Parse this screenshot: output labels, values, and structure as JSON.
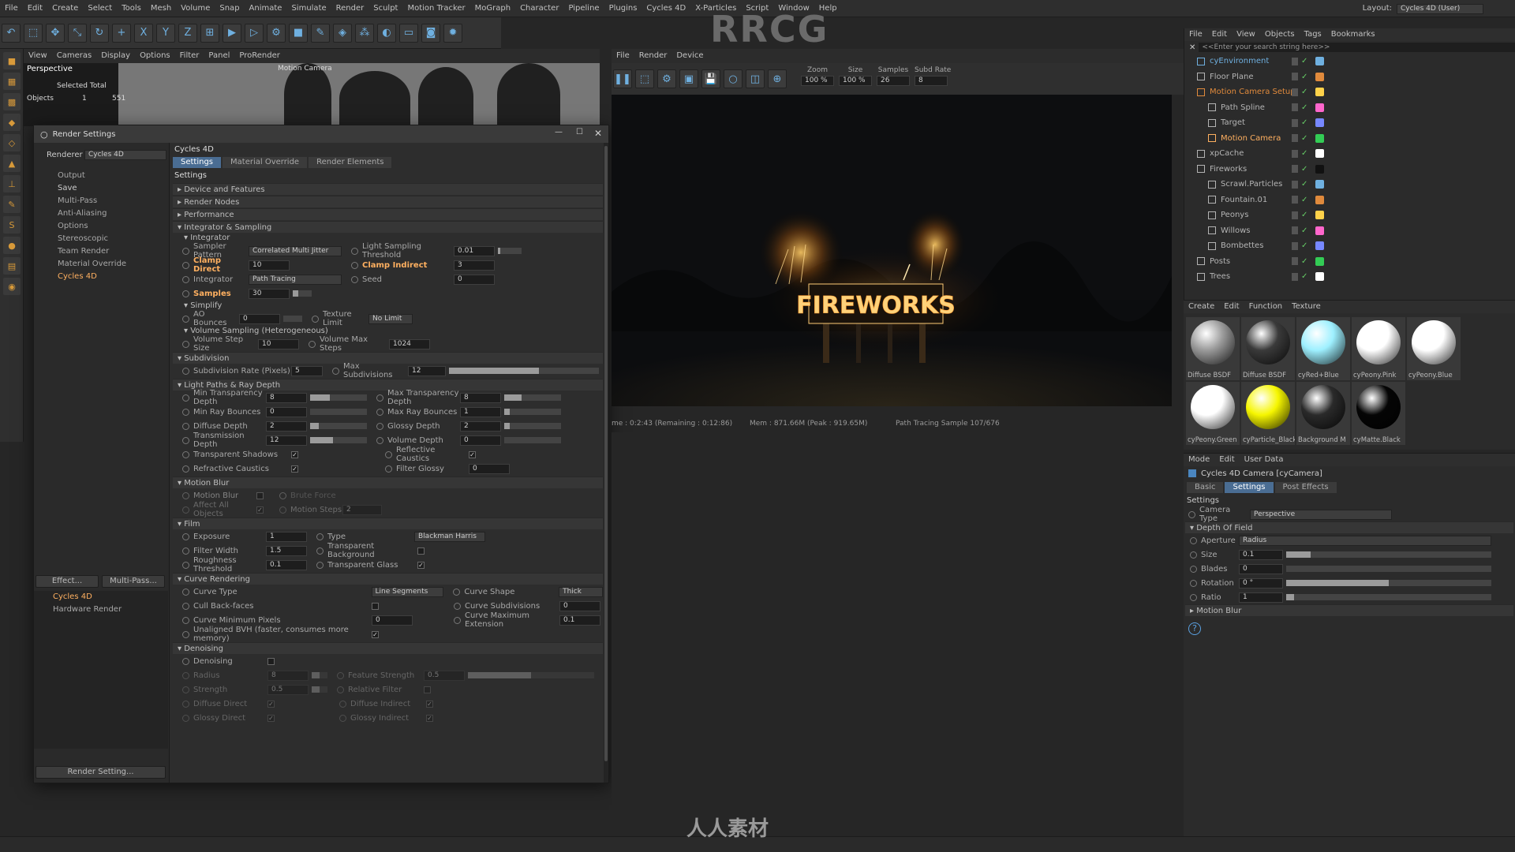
{
  "menubar": {
    "items": [
      "File",
      "Edit",
      "Create",
      "Select",
      "Tools",
      "Mesh",
      "Volume",
      "Snap",
      "Animate",
      "Simulate",
      "Render",
      "Sculpt",
      "Motion Tracker",
      "MoGraph",
      "Character",
      "Pipeline",
      "Plugins",
      "Cycles 4D",
      "X-Particles",
      "Script",
      "Window",
      "Help"
    ],
    "layout_label": "Layout:",
    "layout_value": "Cycles 4D (User)"
  },
  "watermark": {
    "top": "RRCG",
    "footer": "人人素材"
  },
  "toolbar": {
    "icons": [
      "undo-icon",
      "select-icon",
      "move-icon",
      "scale-icon",
      "rotate-icon",
      "add-icon",
      "x-axis-icon",
      "y-axis-icon",
      "z-axis-icon",
      "coord-icon",
      "render-view-icon",
      "render-pv-icon",
      "render-settings-icon",
      "cube-icon",
      "pen-icon",
      "subdiv-icon",
      "array-icon",
      "deformer-icon",
      "floor-icon",
      "camera-icon",
      "light-icon"
    ]
  },
  "viewport": {
    "menu": [
      "View",
      "Cameras",
      "Display",
      "Options",
      "Filter",
      "Panel",
      "ProRender"
    ],
    "name": "Perspective",
    "camera": "Motion Camera ",
    "selected_total": "Selected Total",
    "objects_label": "Objects",
    "objects_value": "1",
    "objects_count": "551"
  },
  "dialog": {
    "title": "Render Settings",
    "renderer_label": "Renderer",
    "renderer_value": "Cycles 4D",
    "left_items": [
      "Output",
      "Save",
      "Multi-Pass",
      "Anti-Aliasing",
      "Options",
      "Stereoscopic",
      "Team Render",
      "Material Override",
      "Cycles 4D"
    ],
    "effect_button": "Effect...",
    "multipass_button": "Multi-Pass...",
    "render_list": [
      "Cycles 4D",
      "Hardware Render"
    ],
    "render_setting_button": "Render Setting...",
    "panel_title": "Cycles 4D",
    "tabs": [
      "Settings",
      "Material Override",
      "Render Elements"
    ],
    "settings_label": "Settings",
    "sections": {
      "device": "Device and Features",
      "nodes": "Render Nodes",
      "performance": "Performance",
      "integrator_sampling": "Integrator & Sampling",
      "integrator": "Integrator",
      "simplify": "Simplify",
      "volume": "Volume Sampling (Heterogeneous)",
      "subdivision": "Subdivision",
      "lightpaths": "Light Paths & Ray Depth",
      "motionblur": "Motion Blur",
      "film": "Film",
      "curve": "Curve Rendering",
      "denoising": "Denoising"
    },
    "integrator": {
      "sampler_pattern_label": "Sampler Pattern",
      "sampler_pattern_value": "Correlated Multi Jitter",
      "light_threshold_label": "Light Sampling Threshold",
      "light_threshold_value": "0.01",
      "clamp_direct_label": "Clamp Direct",
      "clamp_direct_value": "10",
      "clamp_indirect_label": "Clamp Indirect",
      "clamp_indirect_value": "3",
      "integrator_label": "Integrator",
      "integrator_value": "Path Tracing",
      "seed_label": "Seed",
      "seed_value": "0",
      "samples_label": "Samples",
      "samples_value": "30"
    },
    "simplify": {
      "ao_label": "AO Bounces",
      "ao_value": "0",
      "texlimit_label": "Texture Limit",
      "texlimit_value": "No Limit"
    },
    "volume": {
      "step_label": "Volume Step Size",
      "step_value": "10",
      "maxsteps_label": "Volume Max Steps",
      "maxsteps_value": "1024"
    },
    "subdivision": {
      "rate_label": "Subdivision Rate (Pixels)",
      "rate_value": "5",
      "max_label": "Max Subdivisions",
      "max_value": "12"
    },
    "lightpaths": {
      "min_trans_label": "Min Transparency Depth",
      "min_trans_value": "8",
      "max_trans_label": "Max Transparency Depth",
      "max_trans_value": "8",
      "min_ray_label": "Min Ray Bounces",
      "min_ray_value": "0",
      "max_ray_label": "Max Ray Bounces",
      "max_ray_value": "1",
      "diffuse_label": "Diffuse Depth",
      "diffuse_value": "2",
      "glossy_label": "Glossy Depth",
      "glossy_value": "2",
      "transmission_label": "Transmission Depth",
      "transmission_value": "12",
      "volume_label": "Volume Depth",
      "volume_value": "0",
      "trans_shadows_label": "Transparent Shadows",
      "refl_caustics_label": "Reflective Caustics",
      "refr_caustics_label": "Refractive Caustics",
      "filter_glossy_label": "Filter Glossy",
      "filter_glossy_value": "0"
    },
    "motionblur": {
      "mb_label": "Motion Blur",
      "brute_label": "Brute Force",
      "affect_label": "Affect All Objects",
      "mb_steps_label": "Motion Steps",
      "mb_steps_value": "2"
    },
    "film": {
      "exposure_label": "Exposure",
      "exposure_value": "1",
      "type_label": "Type",
      "type_value": "Blackman Harris",
      "filter_width_label": "Filter Width",
      "filter_width_value": "1.5",
      "trans_bg_label": "Transparent Background",
      "roughness_label": "Roughness Threshold",
      "roughness_value": "0.1",
      "trans_glass_label": "Transparent Glass"
    },
    "curve": {
      "type_label": "Curve Type",
      "type_value": "Line Segments",
      "shape_label": "Curve Shape",
      "shape_value": "Thick",
      "cull_label": "Cull Back-faces",
      "subdiv_label": "Curve Subdivisions",
      "subdiv_value": "0",
      "minpix_label": "Curve Minimum Pixels",
      "minpix_value": "0",
      "maxext_label": "Curve Maximum Extension",
      "maxext_value": "0.1",
      "bvh_label": "Unaligned BVH (faster, consumes more memory)"
    },
    "denoising": {
      "denoise_label": "Denoising",
      "radius_label": "Radius",
      "radius_value": "8",
      "feature_label": "Feature Strength",
      "feature_value": "0.5",
      "strength_label": "Strength",
      "strength_value": "0.5",
      "relative_label": "Relative Filter",
      "diffuse_direct_label": "Diffuse Direct",
      "diffuse_indirect_label": "Diffuse Indirect",
      "glossy_direct_label": "Glossy Direct",
      "glossy_indirect_label": "Glossy Indirect"
    }
  },
  "renderview": {
    "menu": [
      "File",
      "Render",
      "Device"
    ],
    "zoom_label": "Zoom",
    "zoom_value": "100 %",
    "size_label": "Size",
    "size_value": "100 %",
    "samples_label": "Samples",
    "samples_value": "26",
    "subd_label": "Subd Rate",
    "subd_value": "8",
    "sign_text": "FIREWORKS",
    "status_time": "me : 0:2:43 (Remaining : 0:12:86)",
    "status_mem": "Mem : 871.66M (Peak : 919.65M)",
    "status_sample": "Path Tracing Sample 107/676"
  },
  "objects": {
    "menu": [
      "File",
      "Edit",
      "View",
      "Objects",
      "Tags",
      "Bookmarks"
    ],
    "search_placeholder": "<<Enter your search string here>>",
    "rows": [
      {
        "name": "cyEnvironment",
        "indent": 0,
        "color": "#6fb0e0"
      },
      {
        "name": "Floor Plane",
        "indent": 0,
        "color": "#b4b4b4"
      },
      {
        "name": "Motion Camera Setup",
        "indent": 0,
        "color": "#e08a3c"
      },
      {
        "name": "Path Spline",
        "indent": 1,
        "color": "#b4b4b4"
      },
      {
        "name": "Target",
        "indent": 1,
        "color": "#b4b4b4"
      },
      {
        "name": "Motion Camera",
        "indent": 1,
        "color": "#ffb060"
      },
      {
        "name": "xpCache",
        "indent": 0,
        "color": "#b4b4b4"
      },
      {
        "name": "Fireworks",
        "indent": 0,
        "color": "#b4b4b4"
      },
      {
        "name": "Scrawl.Particles",
        "indent": 1,
        "color": "#b4b4b4"
      },
      {
        "name": "Fountain.01",
        "indent": 1,
        "color": "#b4b4b4"
      },
      {
        "name": "Peonys",
        "indent": 1,
        "color": "#b4b4b4"
      },
      {
        "name": "Willows",
        "indent": 1,
        "color": "#b4b4b4"
      },
      {
        "name": "Bombettes",
        "indent": 1,
        "color": "#b4b4b4"
      },
      {
        "name": "Posts",
        "indent": 0,
        "color": "#b4b4b4"
      },
      {
        "name": "Trees",
        "indent": 0,
        "color": "#b4b4b4"
      }
    ]
  },
  "materials": {
    "menu": [
      "Create",
      "Edit",
      "Function",
      "Texture"
    ],
    "items": [
      {
        "name": "Diffuse BSDF",
        "color": "#9a9a9a"
      },
      {
        "name": "Diffuse BSDF",
        "color": "#3a3a3a"
      },
      {
        "name": "cyRed+Blue",
        "color": "#9ef0ff"
      },
      {
        "name": "cyPeony.Pink",
        "color": "#ffffff"
      },
      {
        "name": "cyPeony.Blue",
        "color": "#ffffff"
      },
      {
        "name": "cyPeony.Green",
        "color": "#ffffff"
      },
      {
        "name": "cyParticle_Black",
        "color": "#f6f600"
      },
      {
        "name": "Background M",
        "color": "#2a2a2a"
      },
      {
        "name": "cyMatte.Black",
        "color": "#050505"
      }
    ]
  },
  "attributes": {
    "menu": [
      "Mode",
      "Edit",
      "User Data"
    ],
    "object_title": "Cycles 4D Camera [cyCamera]",
    "tabs": [
      "Basic",
      "Settings",
      "Post Effects"
    ],
    "settings_label": "Settings",
    "camera_type_label": "Camera Type",
    "camera_type_value": "Perspective",
    "dof_label": "Depth Of Field",
    "aperture_label": "Aperture",
    "aperture_value": "Radius",
    "size_label": "Size",
    "size_value": "0.1",
    "blades_label": "Blades",
    "blades_value": "0",
    "rotation_label": "Rotation",
    "rotation_value": "0 °",
    "ratio_label": "Ratio",
    "ratio_value": "1",
    "motion_blur_label": "Motion Blur"
  }
}
